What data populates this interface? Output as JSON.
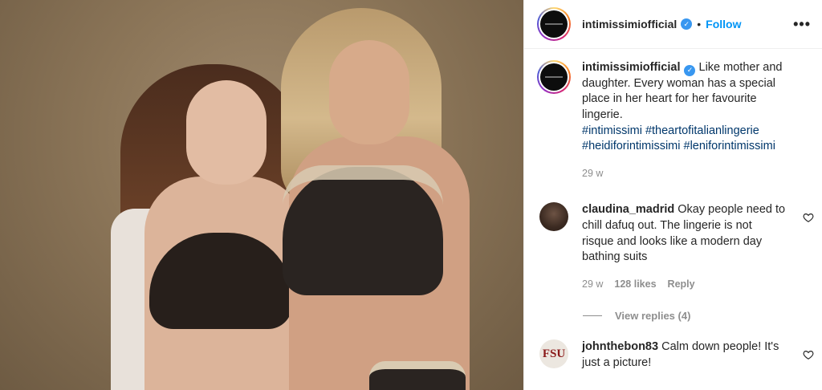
{
  "post": {
    "username": "intimissimiofficial",
    "follow_label": "Follow",
    "more_label": "•••",
    "caption": "Like mother and daughter. Every woman has a special place in her heart for her favourite lingerie.",
    "hashtags": "#intimissimi #theartofitalianlingerie #heidiforintimissimi #leniforintimissimi",
    "age": "29 w"
  },
  "comments": [
    {
      "username": "claudina_madrid",
      "text": "Okay people need to chill dafuq out. The lingerie is not risque and looks like a modern day bathing suits",
      "age": "29 w",
      "likes": "128 likes",
      "reply_label": "Reply",
      "view_replies": "View replies (4)"
    },
    {
      "username": "johnthebon83",
      "text": "Calm down people! It's just a picture!",
      "avatar_text": "FSU"
    }
  ],
  "colors": {
    "link": "#0095f6",
    "hashtag": "#00376b",
    "verified": "#3897f0",
    "muted": "#8e8e8e"
  },
  "icons": [
    "verified-badge-icon",
    "more-options-icon",
    "heart-icon"
  ]
}
